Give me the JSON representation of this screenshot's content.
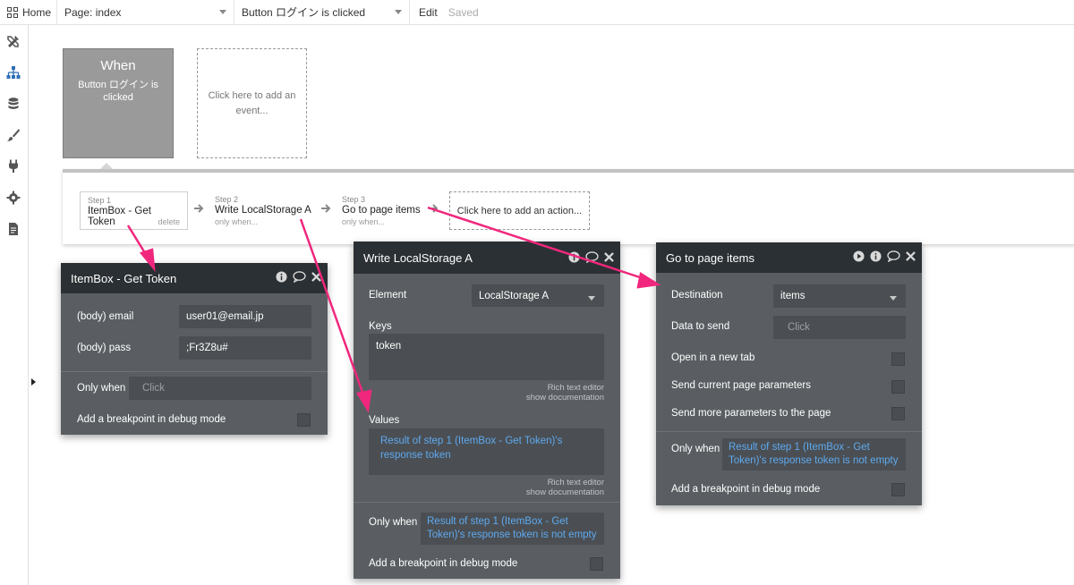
{
  "topbar": {
    "home_label": "Home",
    "page_selector": "Page: index",
    "event_selector": "Button ログイン is clicked",
    "edit_label": "Edit",
    "saved_label": "Saved"
  },
  "sidebar": {
    "items": [
      {
        "icon": "design-icon"
      },
      {
        "icon": "workflow-icon"
      },
      {
        "icon": "data-icon"
      },
      {
        "icon": "styles-icon"
      },
      {
        "icon": "plugins-icon"
      },
      {
        "icon": "settings-icon"
      },
      {
        "icon": "logs-icon"
      }
    ]
  },
  "event": {
    "title": "When",
    "description": "Button ログイン is clicked",
    "add_event_label": "Click here to add an event..."
  },
  "steps": [
    {
      "number": "Step 1",
      "title": "ItemBox - Get Token",
      "sub": "delete"
    },
    {
      "number": "Step 2",
      "title": "Write LocalStorage A",
      "sub": "only when..."
    },
    {
      "number": "Step 3",
      "title": "Go to page items",
      "sub": "only when..."
    }
  ],
  "add_action_label": "Click here to add an action...",
  "panel1": {
    "title": "ItemBox - Get Token",
    "email_label": "(body) email",
    "email_value": "user01@email.jp",
    "pass_label": "(body) pass",
    "pass_value": ";Fr3Z8u#",
    "only_when_label": "Only when",
    "only_when_placeholder": "Click",
    "breakpoint_label": "Add a breakpoint in debug mode"
  },
  "panel2": {
    "title": "Write LocalStorage A",
    "element_label": "Element",
    "element_value": "LocalStorage A",
    "keys_label": "Keys",
    "keys_value": "token",
    "rich_text_label": "Rich text editor",
    "show_docs_label": "show documentation",
    "values_label": "Values",
    "values_value": "Result of step 1 (ItemBox - Get Token)'s response token",
    "rich_text_label2": "Rich text editor",
    "show_docs_label2": "show documentation",
    "only_when_label": "Only when",
    "only_when_value": "Result of step 1 (ItemBox - Get Token)'s response token is not empty",
    "breakpoint_label": "Add a breakpoint in debug mode"
  },
  "panel3": {
    "title": "Go to page items",
    "destination_label": "Destination",
    "destination_value": "items",
    "data_label": "Data to send",
    "data_placeholder": "Click",
    "new_tab_label": "Open in a new tab",
    "send_params_label": "Send current page parameters",
    "send_more_label": "Send more parameters to the page",
    "only_when_label": "Only when",
    "only_when_value": "Result of step 1 (ItemBox - Get Token)'s response token is not empty",
    "breakpoint_label": "Add a breakpoint in debug mode"
  },
  "colors": {
    "annotation_arrow": "#f0277c",
    "panel_bg": "#5a5e62",
    "panel_header": "#2b3034",
    "expression_blue": "#5ea9f0"
  }
}
